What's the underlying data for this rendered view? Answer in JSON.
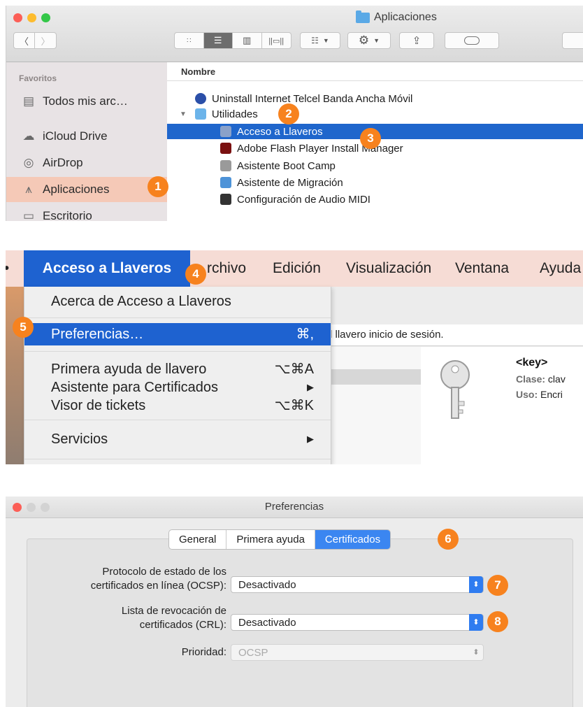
{
  "finder": {
    "window_title": "Aplicaciones",
    "sidebar": {
      "heading": "Favoritos",
      "items": [
        {
          "label": "Todos mis arc…",
          "icon": "documents-icon"
        },
        {
          "label": "iCloud Drive",
          "icon": "cloud-icon"
        },
        {
          "label": "AirDrop",
          "icon": "airdrop-icon"
        },
        {
          "label": "Aplicaciones",
          "icon": "applications-icon",
          "selected": true
        },
        {
          "label": "Escritorio",
          "icon": "desktop-icon"
        }
      ]
    },
    "column_header": "Nombre",
    "rows": [
      {
        "label": "Uninstall Internet Telcel Banda Ancha Móvil",
        "icon": "uninstall-icon"
      },
      {
        "label": "Utilidades",
        "icon": "folder-icon",
        "disclosure": true
      },
      {
        "label": "Acceso a Llaveros",
        "icon": "keychain-icon",
        "selected": true
      },
      {
        "label": "Adobe Flash Player Install Manager",
        "icon": "flash-icon"
      },
      {
        "label": "Asistente Boot Camp",
        "icon": "bootcamp-icon"
      },
      {
        "label": "Asistente de Migración",
        "icon": "migration-icon"
      },
      {
        "label": "Configuración de Audio MIDI",
        "icon": "midi-icon"
      }
    ]
  },
  "menu": {
    "menubar": [
      "Acceso a Llaveros",
      "rchivo",
      "Edición",
      "Visualización",
      "Ventana",
      "Ayuda"
    ],
    "dropdown": [
      {
        "label": "Acerca de Acceso a Llaveros",
        "shortcut": ""
      },
      {
        "label": "Preferencias…",
        "shortcut": "⌘,",
        "highlighted": true
      },
      {
        "label": "Primera ayuda de llavero",
        "shortcut": "⌥⌘A"
      },
      {
        "label": "Asistente para Certificados",
        "shortcut": "▶"
      },
      {
        "label": "Visor de tickets",
        "shortcut": "⌥⌘K"
      },
      {
        "label": "Servicios",
        "shortcut": "▶"
      }
    ],
    "behind": {
      "status_text": "l llavero inicio de sesión.",
      "item_title": "<key>",
      "clase_label": "Clase:",
      "clase_value": "clav",
      "uso_label": "Uso:",
      "uso_value": "Encri"
    }
  },
  "prefs": {
    "window_title": "Preferencias",
    "tabs": [
      "General",
      "Primera ayuda",
      "Certificados"
    ],
    "active_tab": "Certificados",
    "fields": [
      {
        "label_line1": "Protocolo de estado de los",
        "label_line2": "certificados en línea (OCSP):",
        "value": "Desactivado"
      },
      {
        "label_line1": "Lista de revocación de",
        "label_line2": "certificados (CRL):",
        "value": "Desactivado"
      },
      {
        "label_line1": "",
        "label_line2": "Prioridad:",
        "value": "OCSP",
        "disabled": true
      }
    ]
  },
  "badges": [
    "1",
    "2",
    "3",
    "4",
    "5",
    "6",
    "7",
    "8"
  ],
  "colors": {
    "badge": "#f7821e",
    "selection": "#1f66cc",
    "accent": "#3b86f1"
  }
}
